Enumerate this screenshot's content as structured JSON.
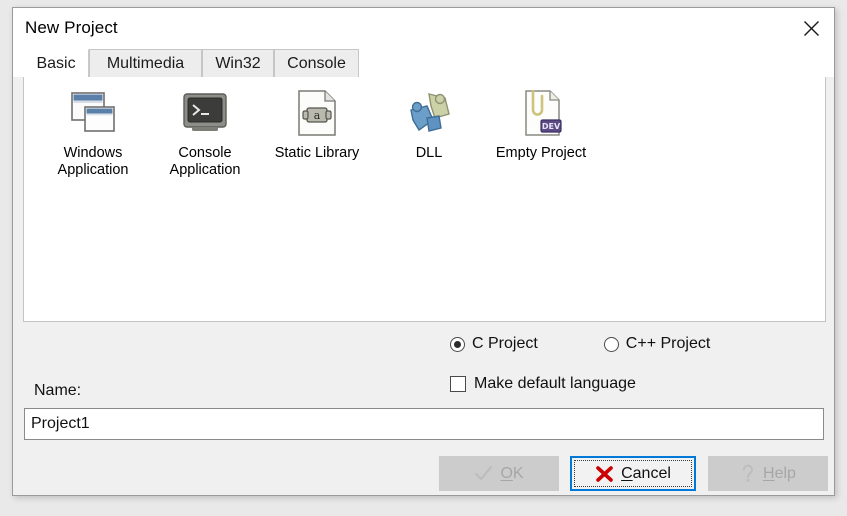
{
  "window": {
    "title": "New Project",
    "close_icon": "close-x-icon"
  },
  "tabs": [
    {
      "label": "Basic",
      "active": true
    },
    {
      "label": "Multimedia",
      "active": false
    },
    {
      "label": "Win32",
      "active": false
    },
    {
      "label": "Console",
      "active": false
    }
  ],
  "templates": [
    {
      "label": "Windows\nApplication",
      "icon": "windows-application-icon"
    },
    {
      "label": "Console\nApplication",
      "icon": "console-application-icon"
    },
    {
      "label": "Static Library",
      "icon": "static-library-icon"
    },
    {
      "label": "DLL",
      "icon": "dll-puzzle-icon"
    },
    {
      "label": "Empty Project",
      "icon": "empty-project-icon"
    }
  ],
  "options": {
    "language_radios": [
      {
        "label": "C Project",
        "selected": true
      },
      {
        "label": "C++ Project",
        "selected": false
      }
    ],
    "make_default": {
      "label": "Make default language",
      "checked": false
    }
  },
  "name_field": {
    "label": "Name:",
    "value": "Project1",
    "placeholder": ""
  },
  "buttons": {
    "ok": {
      "label": "OK",
      "accel": "O",
      "icon": "checkmark-icon",
      "state": "disabled"
    },
    "cancel": {
      "label": "Cancel",
      "accel": "C",
      "icon": "red-x-icon",
      "state": "focused"
    },
    "help": {
      "label": "Help",
      "accel": "H",
      "icon": "question-mark-icon",
      "state": "disabled"
    }
  },
  "colors": {
    "dialog_background": "#f0f0f0",
    "panel_background": "#ffffff",
    "focus_blue": "#0078d7",
    "cancel_x_red": "#cc0000",
    "disabled_button": "#cccccc",
    "disabled_text": "#a6a6a6",
    "desktop_background": "#e9e9e9"
  }
}
